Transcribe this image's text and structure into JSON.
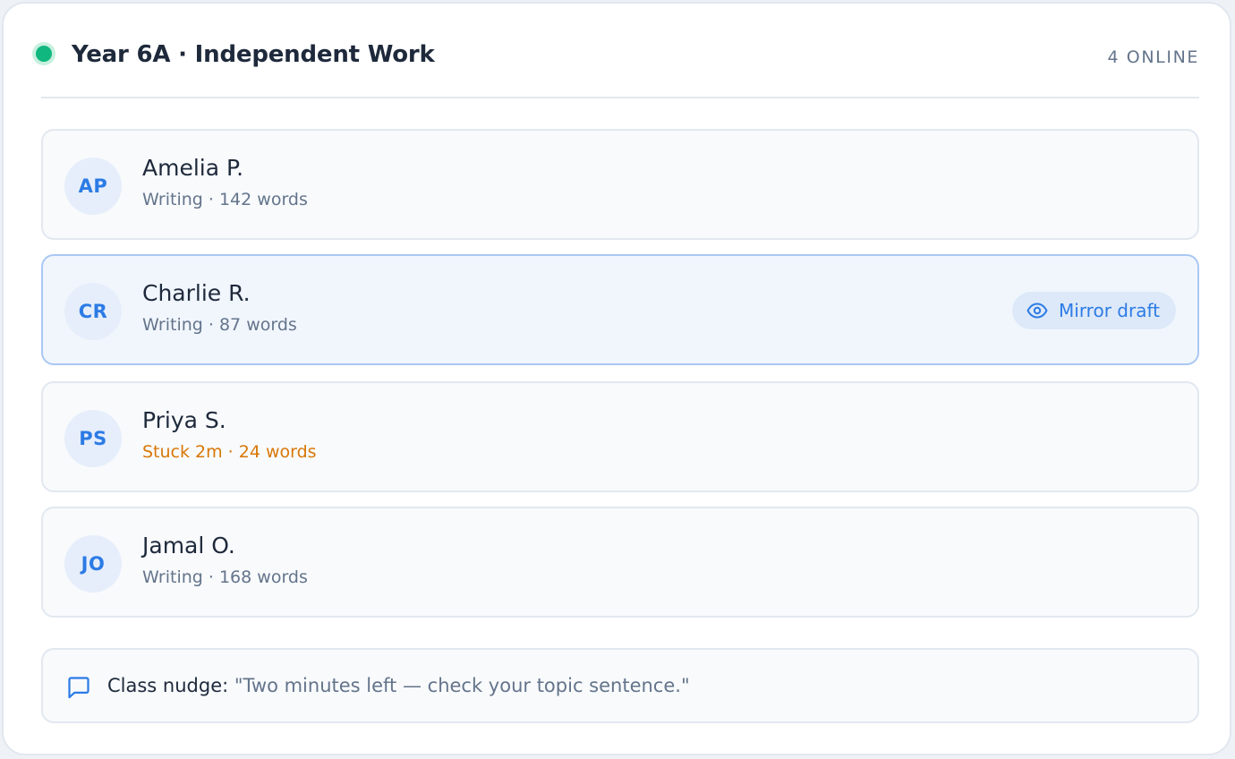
{
  "header": {
    "title": "Year 6A · Independent Work",
    "online_count": "4 ONLINE",
    "status_color": "#10b77f"
  },
  "students": [
    {
      "initials": "AP",
      "name": "Amelia P.",
      "status": "Writing · 142 words",
      "state": "normal"
    },
    {
      "initials": "CR",
      "name": "Charlie R.",
      "status": "Writing · 87 words",
      "state": "selected",
      "action_label": "Mirror draft",
      "action_icon": "eye-icon"
    },
    {
      "initials": "PS",
      "name": "Priya S.",
      "status": "Stuck 2m · 24 words",
      "state": "stuck"
    },
    {
      "initials": "JO",
      "name": "Jamal O.",
      "status": "Writing · 168 words",
      "state": "normal"
    }
  ],
  "nudge": {
    "icon": "message-square-icon",
    "label": "Class nudge:",
    "message": "\"Two minutes left — check your topic sentence.\""
  },
  "colors": {
    "accent": "#2c7be5",
    "warning": "#d97706",
    "online": "#10b77f"
  }
}
